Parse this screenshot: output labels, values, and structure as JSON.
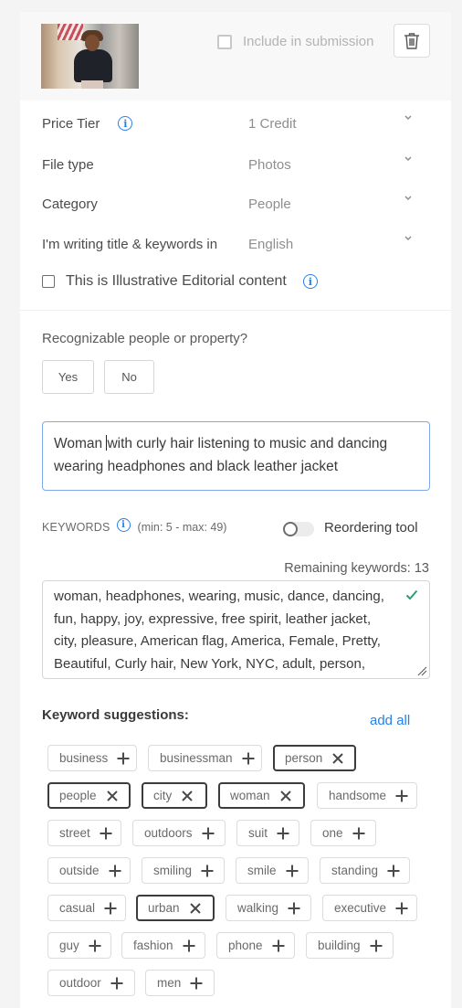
{
  "header": {
    "thumbnail_alt": "Woman with curly hair dancing in headphones on a city street",
    "include_label": "Include in submission",
    "include_checked": false,
    "delete_icon": "trash-icon"
  },
  "fields": [
    {
      "label": "Price Tier",
      "value": "1 Credit",
      "has_info": true
    },
    {
      "label": "File type",
      "value": "Photos",
      "has_info": false
    },
    {
      "label": "Category",
      "value": "People",
      "has_info": false
    },
    {
      "label": "I'm writing title & keywords in",
      "value": "English",
      "has_info": false
    }
  ],
  "editorial": {
    "label": "This is Illustrative Editorial content",
    "checked": false
  },
  "recognizable": {
    "question": "Recognizable people or property?",
    "yes_label": "Yes",
    "no_label": "No"
  },
  "title": {
    "before_caret": "Woman ",
    "after_caret": "with curly hair listening to music and dancing wearing headphones and black leather jacket"
  },
  "keywords": {
    "label": "KEYWORDS",
    "range": "(min: 5 - max: 49)",
    "reorder_label": "Reordering tool",
    "reorder_enabled": false,
    "remaining": "Remaining keywords: 13",
    "text": "woman, headphones, wearing, music, dance, dancing, fun, happy, joy, expressive, free spirit, leather jacket, city, pleasure, American flag, America, Female, Pretty, Beautiful, Curly hair, New York, NYC, adult, person,",
    "valid_color": "#2d9d78"
  },
  "suggestions": {
    "title": "Keyword suggestions:",
    "add_all": "add all",
    "accent": "#2680eb",
    "chips": [
      {
        "label": "business",
        "selected": false
      },
      {
        "label": "businessman",
        "selected": false
      },
      {
        "label": "person",
        "selected": true
      },
      {
        "label": "people",
        "selected": true
      },
      {
        "label": "city",
        "selected": true
      },
      {
        "label": "woman",
        "selected": true
      },
      {
        "label": "handsome",
        "selected": false
      },
      {
        "label": "street",
        "selected": false
      },
      {
        "label": "outdoors",
        "selected": false
      },
      {
        "label": "suit",
        "selected": false
      },
      {
        "label": "one",
        "selected": false
      },
      {
        "label": "outside",
        "selected": false
      },
      {
        "label": "smiling",
        "selected": false
      },
      {
        "label": "smile",
        "selected": false
      },
      {
        "label": "standing",
        "selected": false
      },
      {
        "label": "casual",
        "selected": false
      },
      {
        "label": "urban",
        "selected": true
      },
      {
        "label": "walking",
        "selected": false
      },
      {
        "label": "executive",
        "selected": false
      },
      {
        "label": "guy",
        "selected": false
      },
      {
        "label": "fashion",
        "selected": false
      },
      {
        "label": "phone",
        "selected": false
      },
      {
        "label": "building",
        "selected": false
      },
      {
        "label": "outdoor",
        "selected": false
      },
      {
        "label": "men",
        "selected": false
      }
    ]
  }
}
